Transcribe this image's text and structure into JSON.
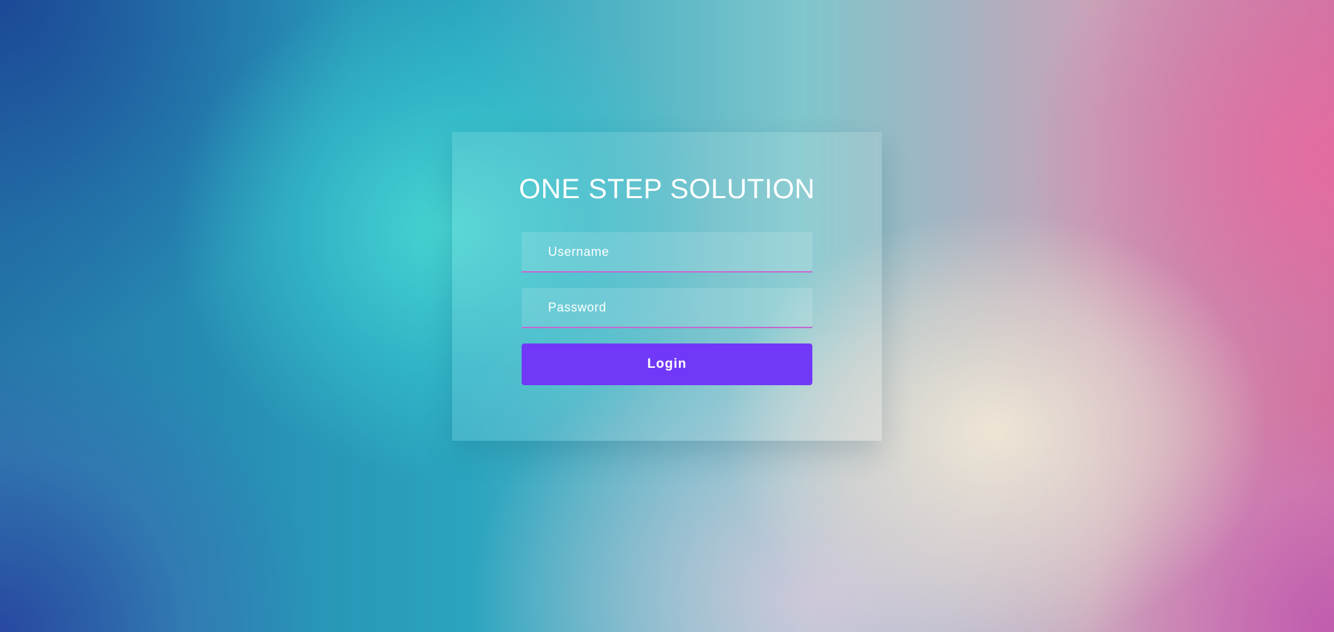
{
  "app": {
    "title": "ONE STEP SOLUTION"
  },
  "login_form": {
    "username": {
      "value": "",
      "placeholder": "Username"
    },
    "password": {
      "value": "",
      "placeholder": "Password"
    },
    "submit_label": "Login"
  },
  "colors": {
    "button": "#7139f7",
    "input_underline": "#c56ad0",
    "text": "#ffffff"
  }
}
